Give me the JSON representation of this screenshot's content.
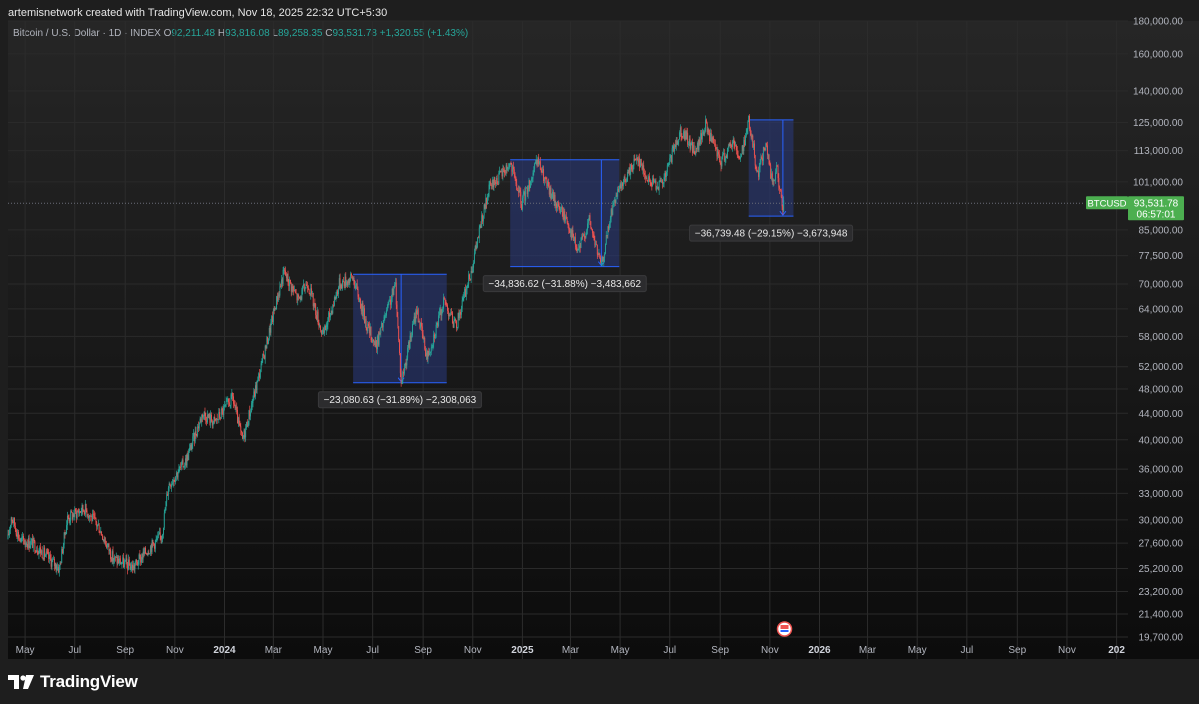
{
  "header": {
    "credit": "artemisnetwork created with TradingView.com, Nov 18, 2025 22:32 UTC+5:30"
  },
  "legend": {
    "symbol": "Bitcoin / U.S. Dollar · 1D · INDEX",
    "open_label": "O",
    "open": "92,211.48",
    "high_label": "H",
    "high": "93,816.08",
    "low_label": "L",
    "low": "89,258.35",
    "close_label": "C",
    "close": "93,531.78",
    "change": "+1,320.55 (+1.43%)"
  },
  "price_tag": {
    "symbol": "BTCUSD",
    "price": "93,531.78",
    "countdown": "06:57:01"
  },
  "brand": {
    "name": "TradingView"
  },
  "colors": {
    "up": "#26a69a",
    "down": "#ef5350",
    "box_fill": "#2a3b80",
    "box_line": "#2962ff",
    "price_tag": "#4caf50"
  },
  "chart_data": {
    "type": "candlestick",
    "y_scale": "log",
    "ylim": [
      19700,
      180000
    ],
    "y_ticks": [
      "180,000.00",
      "160,000.00",
      "140,000.00",
      "125,000.00",
      "113,000.00",
      "101,000.00",
      "93,531.78",
      "85,000.00",
      "77,500.00",
      "70,000.00",
      "64,000.00",
      "58,000.00",
      "52,000.00",
      "48,000.00",
      "44,000.00",
      "40,000.00",
      "36,000.00",
      "33,000.00",
      "30,000.00",
      "27,600.00",
      "25,200.00",
      "23,200.00",
      "21,400.00",
      "19,700.00"
    ],
    "y_tick_values": [
      180000,
      160000,
      140000,
      125000,
      113000,
      101000,
      93531.78,
      85000,
      77500,
      70000,
      64000,
      58000,
      52000,
      48000,
      44000,
      40000,
      36000,
      33000,
      30000,
      27600,
      25200,
      23200,
      21400,
      19700
    ],
    "x_ticks": [
      "May",
      "Jul",
      "Sep",
      "Nov",
      "2024",
      "Mar",
      "May",
      "Jul",
      "Sep",
      "Nov",
      "2025",
      "Mar",
      "May",
      "Jul",
      "Sep",
      "Nov",
      "2026",
      "Mar",
      "May",
      "Jul",
      "Sep",
      "Nov",
      "202"
    ],
    "x_tick_dates": [
      "2023-05-01",
      "2023-07-01",
      "2023-09-01",
      "2023-11-01",
      "2024-01-01",
      "2024-03-01",
      "2024-05-01",
      "2024-07-01",
      "2024-09-01",
      "2024-11-01",
      "2025-01-01",
      "2025-03-01",
      "2025-05-01",
      "2025-07-01",
      "2025-09-01",
      "2025-11-01",
      "2026-01-01",
      "2026-03-01",
      "2026-05-01",
      "2026-07-01",
      "2026-09-01",
      "2026-11-01",
      "2027-01-01"
    ],
    "x_range": [
      "2023-04-10",
      "2027-01-15"
    ],
    "price_path": [
      [
        "2023-04-10",
        28000
      ],
      [
        "2023-04-14",
        30400
      ],
      [
        "2023-04-25",
        27900
      ],
      [
        "2023-05-10",
        27600
      ],
      [
        "2023-05-25",
        26500
      ],
      [
        "2023-06-12",
        25200
      ],
      [
        "2023-06-22",
        30200
      ],
      [
        "2023-07-13",
        31300
      ],
      [
        "2023-07-31",
        29200
      ],
      [
        "2023-08-17",
        26100
      ],
      [
        "2023-09-11",
        25300
      ],
      [
        "2023-09-29",
        27000
      ],
      [
        "2023-10-16",
        28400
      ],
      [
        "2023-10-24",
        34000
      ],
      [
        "2023-11-15",
        37200
      ],
      [
        "2023-12-05",
        44000
      ],
      [
        "2023-12-20",
        42600
      ],
      [
        "2024-01-11",
        46500
      ],
      [
        "2024-01-23",
        39800
      ],
      [
        "2024-02-15",
        52000
      ],
      [
        "2024-03-05",
        66000
      ],
      [
        "2024-03-14",
        73100
      ],
      [
        "2024-04-01",
        66000
      ],
      [
        "2024-04-12",
        70600
      ],
      [
        "2024-05-01",
        58000
      ],
      [
        "2024-05-21",
        70100
      ],
      [
        "2024-06-07",
        71600
      ],
      [
        "2024-06-24",
        60300
      ],
      [
        "2024-07-05",
        56000
      ],
      [
        "2024-07-29",
        69800
      ],
      [
        "2024-08-05",
        49100
      ],
      [
        "2024-08-24",
        64000
      ],
      [
        "2024-09-06",
        53800
      ],
      [
        "2024-09-27",
        66000
      ],
      [
        "2024-10-11",
        60000
      ],
      [
        "2024-10-29",
        72500
      ],
      [
        "2024-11-12",
        88000
      ],
      [
        "2024-11-22",
        99000
      ],
      [
        "2024-12-05",
        103500
      ],
      [
        "2024-12-17",
        108000
      ],
      [
        "2024-12-31",
        93500
      ],
      [
        "2025-01-20",
        108800
      ],
      [
        "2025-02-03",
        97500
      ],
      [
        "2025-02-25",
        88000
      ],
      [
        "2025-03-10",
        78500
      ],
      [
        "2025-03-24",
        88000
      ],
      [
        "2025-04-08",
        74500
      ],
      [
        "2025-04-22",
        93000
      ],
      [
        "2025-05-22",
        111000
      ],
      [
        "2025-06-05",
        101000
      ],
      [
        "2025-06-22",
        100000
      ],
      [
        "2025-07-14",
        122000
      ],
      [
        "2025-08-02",
        112500
      ],
      [
        "2025-08-14",
        124000
      ],
      [
        "2025-09-01",
        108500
      ],
      [
        "2025-09-18",
        117500
      ],
      [
        "2025-09-25",
        109000
      ],
      [
        "2025-10-06",
        125800
      ],
      [
        "2025-10-17",
        104000
      ],
      [
        "2025-10-27",
        115800
      ],
      [
        "2025-11-04",
        100500
      ],
      [
        "2025-11-10",
        106000
      ],
      [
        "2025-11-17",
        89300
      ],
      [
        "2025-11-18",
        93531.78
      ]
    ],
    "measures": [
      {
        "label": "−23,080.63 (−31.89%) −2,308,063",
        "start": "2024-06-07",
        "end": "2024-09-30",
        "high": 72500,
        "low": 49100,
        "peak_date": "2024-06-07",
        "trough_date": "2024-08-05"
      },
      {
        "label": "−34,836.62 (−31.88%) −3,483,662",
        "start": "2024-12-17",
        "end": "2025-04-30",
        "high": 109350,
        "low": 74500,
        "peak_date": "2025-01-20",
        "trough_date": "2025-04-08"
      },
      {
        "label": "−36,739.48 (−29.15%) −3,673,948",
        "start": "2025-10-06",
        "end": "2025-11-30",
        "high": 126200,
        "low": 89300,
        "peak_date": "2025-10-06",
        "trough_date": "2025-11-17"
      }
    ],
    "event_marker_date": "2025-11-19",
    "grid": true
  }
}
